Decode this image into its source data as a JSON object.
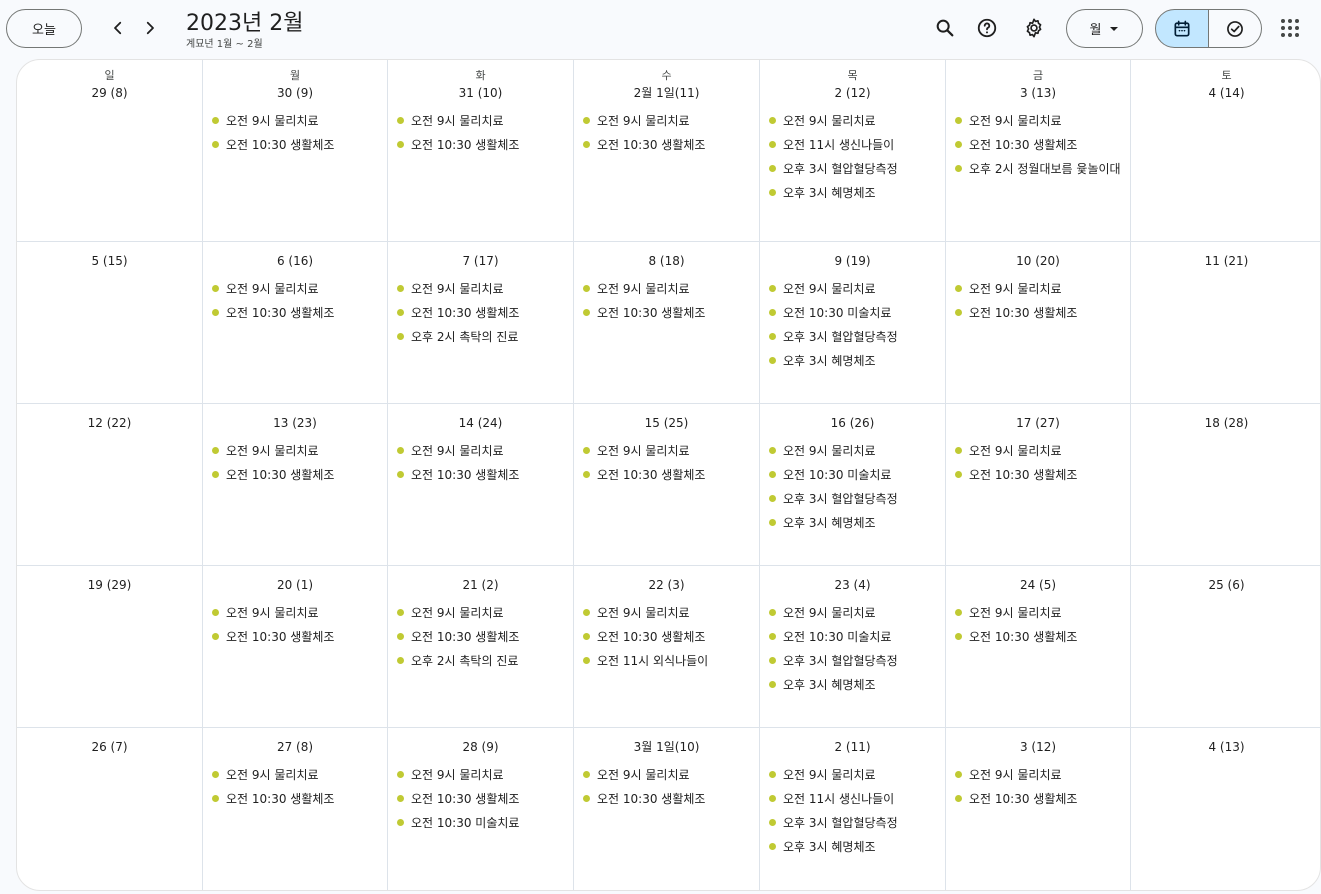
{
  "toolbar": {
    "today_label": "오늘",
    "title": "2023년 2월",
    "subtitle": "계묘년 1월 ~ 2월",
    "view_label": "월",
    "icons": [
      "chevron-left-icon",
      "chevron-right-icon",
      "search-icon",
      "help-icon",
      "settings-icon",
      "dropdown-arrow-icon",
      "calendar-icon",
      "tasks-icon",
      "apps-grid-icon"
    ]
  },
  "colors": {
    "event_dot": "#c0ca33",
    "active_segment": "#c2e7ff"
  },
  "days_of_week": [
    "일",
    "월",
    "화",
    "수",
    "목",
    "금",
    "토"
  ],
  "weeks": [
    [
      {
        "date": "29 (8)",
        "events": []
      },
      {
        "date": "30 (9)",
        "events": [
          "오전 9시 물리치료",
          "오전 10:30 생활체조"
        ]
      },
      {
        "date": "31 (10)",
        "events": [
          "오전 9시 물리치료",
          "오전 10:30 생활체조"
        ]
      },
      {
        "date": "2월 1일(11)",
        "events": [
          "오전 9시 물리치료",
          "오전 10:30 생활체조"
        ]
      },
      {
        "date": "2 (12)",
        "events": [
          "오전 9시 물리치료",
          "오전 11시 생신나들이",
          "오후 3시 혈압혈당측정",
          "오후 3시 혜명체조"
        ]
      },
      {
        "date": "3 (13)",
        "events": [
          "오전 9시 물리치료",
          "오전 10:30 생활체조",
          "오후 2시 정월대보름 윷놀이대"
        ]
      },
      {
        "date": "4 (14)",
        "events": []
      }
    ],
    [
      {
        "date": "5 (15)",
        "events": []
      },
      {
        "date": "6 (16)",
        "events": [
          "오전 9시 물리치료",
          "오전 10:30 생활체조"
        ]
      },
      {
        "date": "7 (17)",
        "events": [
          "오전 9시 물리치료",
          "오전 10:30 생활체조",
          "오후 2시 촉탁의 진료"
        ]
      },
      {
        "date": "8 (18)",
        "events": [
          "오전 9시 물리치료",
          "오전 10:30 생활체조"
        ]
      },
      {
        "date": "9 (19)",
        "events": [
          "오전 9시 물리치료",
          "오전 10:30 미술치료",
          "오후 3시 혈압혈당측정",
          "오후 3시 혜명체조"
        ]
      },
      {
        "date": "10 (20)",
        "events": [
          "오전 9시 물리치료",
          "오전 10:30 생활체조"
        ]
      },
      {
        "date": "11 (21)",
        "events": []
      }
    ],
    [
      {
        "date": "12 (22)",
        "events": []
      },
      {
        "date": "13 (23)",
        "events": [
          "오전 9시 물리치료",
          "오전 10:30 생활체조"
        ]
      },
      {
        "date": "14 (24)",
        "events": [
          "오전 9시 물리치료",
          "오전 10:30 생활체조"
        ]
      },
      {
        "date": "15 (25)",
        "events": [
          "오전 9시 물리치료",
          "오전 10:30 생활체조"
        ]
      },
      {
        "date": "16 (26)",
        "events": [
          "오전 9시 물리치료",
          "오전 10:30 미술치료",
          "오후 3시 혈압혈당측정",
          "오후 3시 혜명체조"
        ]
      },
      {
        "date": "17 (27)",
        "events": [
          "오전 9시 물리치료",
          "오전 10:30 생활체조"
        ]
      },
      {
        "date": "18 (28)",
        "events": []
      }
    ],
    [
      {
        "date": "19 (29)",
        "events": []
      },
      {
        "date": "20 (1)",
        "events": [
          "오전 9시 물리치료",
          "오전 10:30 생활체조"
        ]
      },
      {
        "date": "21 (2)",
        "events": [
          "오전 9시 물리치료",
          "오전 10:30 생활체조",
          "오후 2시 촉탁의 진료"
        ]
      },
      {
        "date": "22 (3)",
        "events": [
          "오전 9시 물리치료",
          "오전 10:30 생활체조",
          "오전 11시 외식나들이"
        ]
      },
      {
        "date": "23 (4)",
        "events": [
          "오전 9시 물리치료",
          "오전 10:30 미술치료",
          "오후 3시 혈압혈당측정",
          "오후 3시 혜명체조"
        ]
      },
      {
        "date": "24 (5)",
        "events": [
          "오전 9시 물리치료",
          "오전 10:30 생활체조"
        ]
      },
      {
        "date": "25 (6)",
        "events": []
      }
    ],
    [
      {
        "date": "26 (7)",
        "events": []
      },
      {
        "date": "27 (8)",
        "events": [
          "오전 9시 물리치료",
          "오전 10:30 생활체조"
        ]
      },
      {
        "date": "28 (9)",
        "events": [
          "오전 9시 물리치료",
          "오전 10:30 생활체조",
          "오전 10:30 미술치료"
        ]
      },
      {
        "date": "3월 1일(10)",
        "events": [
          "오전 9시 물리치료",
          "오전 10:30 생활체조"
        ]
      },
      {
        "date": "2 (11)",
        "events": [
          "오전 9시 물리치료",
          "오전 11시 생신나들이",
          "오후 3시 혈압혈당측정",
          "오후 3시 혜명체조"
        ]
      },
      {
        "date": "3 (12)",
        "events": [
          "오전 9시 물리치료",
          "오전 10:30 생활체조"
        ]
      },
      {
        "date": "4 (13)",
        "events": []
      }
    ]
  ]
}
